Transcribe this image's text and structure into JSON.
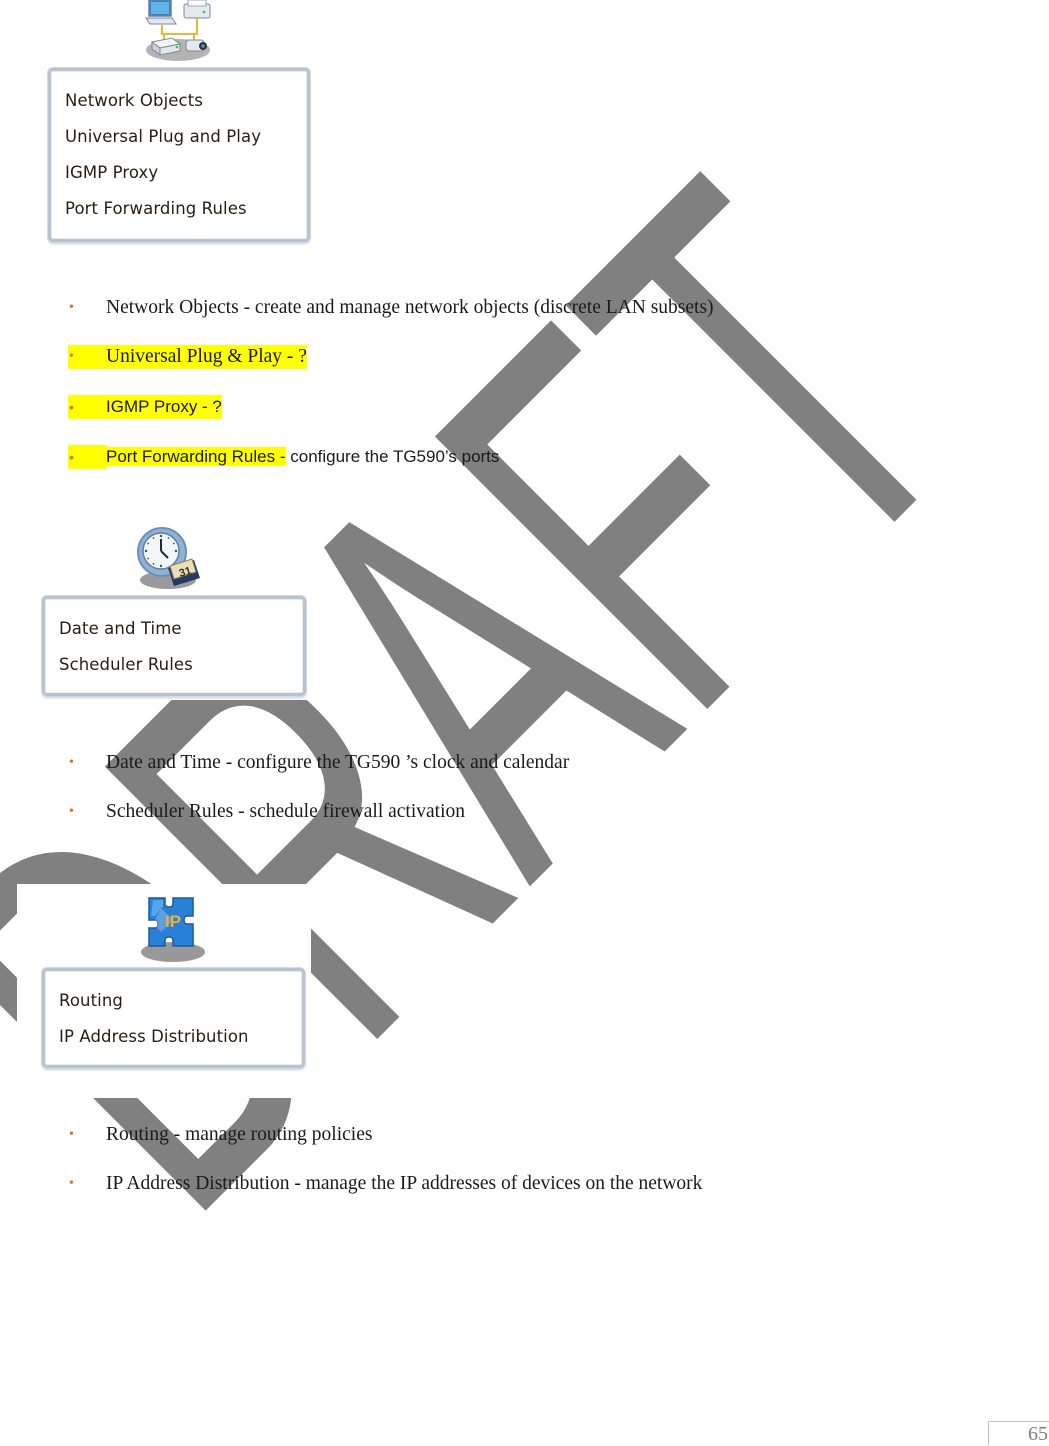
{
  "watermark": {
    "text": "DRAFT",
    "color": "#808080"
  },
  "sections": [
    {
      "icon": "network-devices-icon",
      "menu_items": [
        "Network Objects",
        "Universal Plug and Play",
        "IGMP Proxy",
        "Port Forwarding Rules"
      ],
      "bullets": [
        {
          "term": "Network Objects",
          "desc": " - create and manage network objects (discrete LAN subsets)",
          "highlight": false
        },
        {
          "term": "Universal Plug & Play - ?",
          "desc": "",
          "highlight": true
        },
        {
          "term": "IGMP Proxy - ?",
          "desc": "",
          "highlight": true
        },
        {
          "term": "Port Forwarding Rules -",
          "desc": " configure the TG590’s ports",
          "highlight": true
        }
      ]
    },
    {
      "icon": "clock-calendar-icon",
      "calendar_day": "31",
      "menu_items": [
        "Date and Time",
        "Scheduler Rules"
      ],
      "bullets": [
        {
          "term": "Date and Time",
          "desc": " - configure the TG590 ’s clock and calendar",
          "highlight": false
        },
        {
          "term": "Scheduler Rules",
          "desc": " - schedule firewall activation",
          "highlight": false
        }
      ]
    },
    {
      "icon": "ip-puzzle-icon",
      "icon_label": "IP",
      "menu_items": [
        "Routing",
        "IP Address Distribution"
      ],
      "bullets": [
        {
          "term": "Routing",
          "desc": " - manage routing policies",
          "highlight": false
        },
        {
          "term": "IP Address Distribution",
          "desc": " - manage the IP addresses of devices on the network",
          "highlight": false
        }
      ]
    }
  ],
  "bullet_glyph": "•",
  "bullet_color": "#e36c0a",
  "highlight_color": "#ffff00",
  "page_number": "65"
}
